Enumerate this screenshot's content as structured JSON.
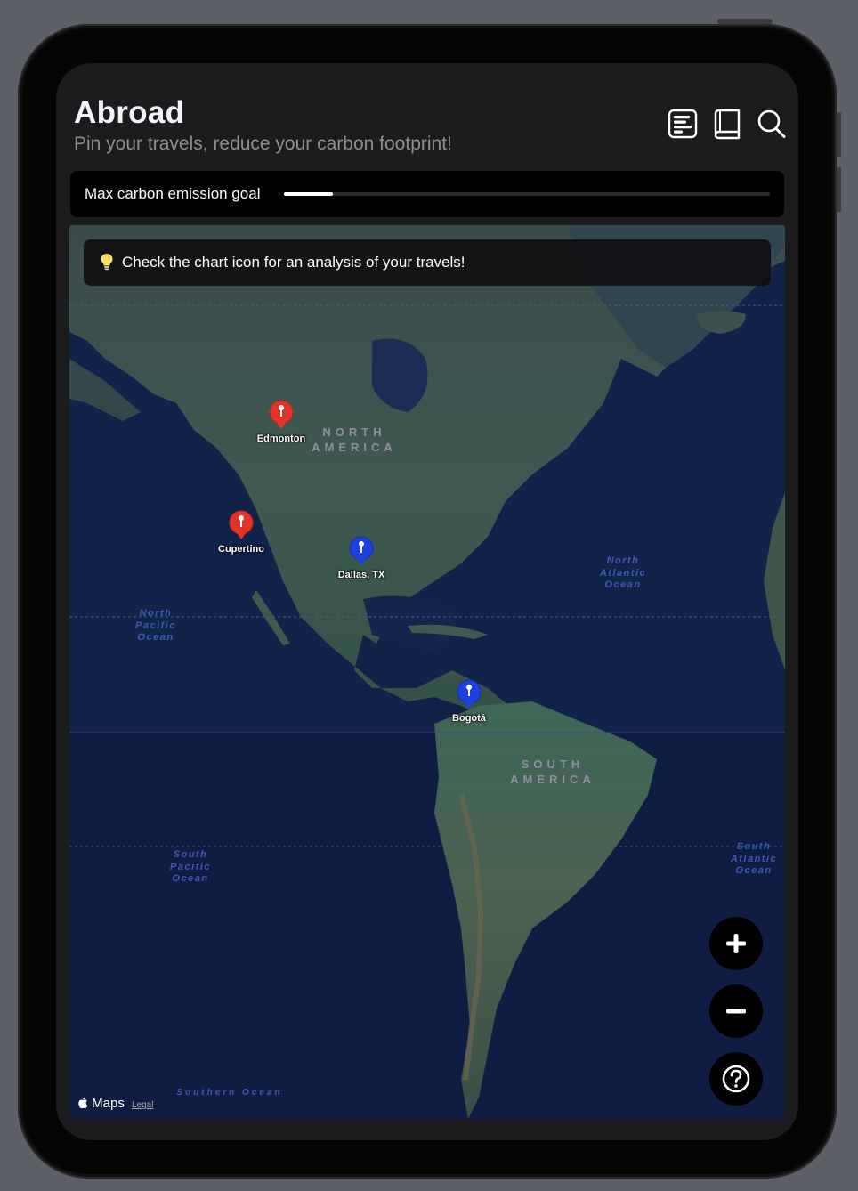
{
  "app": {
    "title": "Abroad",
    "subtitle": "Pin your travels, reduce your carbon footprint!"
  },
  "toolbar": {
    "icons": [
      "chart-icon",
      "book-icon",
      "search-icon"
    ]
  },
  "goal": {
    "label": "Max carbon emission goal",
    "fraction": 0.1
  },
  "tip": {
    "icon": "lightbulb-icon",
    "text": "Check the chart icon for an analysis of your travels!"
  },
  "map": {
    "regions": {
      "north_america_1": "NORTH",
      "north_america_2": "AMERICA",
      "south_america_1": "SOUTH",
      "south_america_2": "AMERICA"
    },
    "oceans": {
      "north_pacific": [
        "North",
        "Pacific",
        "Ocean"
      ],
      "north_atlantic": [
        "North",
        "Atlantic",
        "Ocean"
      ],
      "south_pacific": [
        "South",
        "Pacific",
        "Ocean"
      ],
      "south_atlantic": [
        "South",
        "Atlantic",
        "Ocean"
      ],
      "southern": "Southern Ocean"
    },
    "pins": [
      {
        "label": "Edmonton",
        "color": "#e03526"
      },
      {
        "label": "Cupertino",
        "color": "#e03526"
      },
      {
        "label": "Dallas, TX",
        "color": "#1f3fe0"
      },
      {
        "label": "Bogotá",
        "color": "#1f3fe0"
      }
    ],
    "attribution": "Maps",
    "legal": "Legal"
  },
  "controls": {
    "zoom_in": "plus-icon",
    "zoom_out": "minus-icon",
    "help": "question-icon"
  }
}
